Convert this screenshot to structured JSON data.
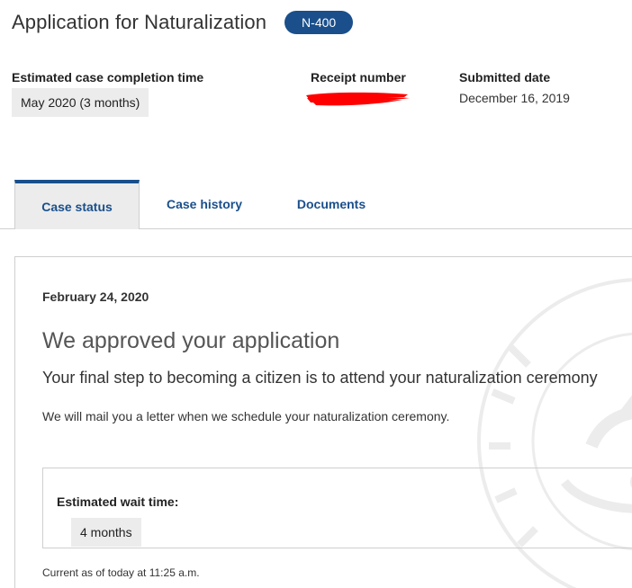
{
  "header": {
    "title": "Application for Naturalization",
    "form_badge": "N-400"
  },
  "meta": {
    "completion_label": "Estimated case completion time",
    "completion_value": "May 2020 (3 months)",
    "receipt_label": "Receipt number",
    "submitted_label": "Submitted date",
    "submitted_value": "December 16, 2019"
  },
  "tabs": [
    {
      "label": "Case status",
      "active": true
    },
    {
      "label": "Case history",
      "active": false
    },
    {
      "label": "Documents",
      "active": false
    }
  ],
  "status": {
    "date": "February 24, 2020",
    "heading": "We approved your application",
    "subheading": "Your final step to becoming a citizen is to attend your naturalization ceremony",
    "body": "We will mail you a letter when we schedule your naturalization ceremony.",
    "wait_label": "Estimated wait time:",
    "wait_value": "4 months",
    "current_as_of": "Current as of today at 11:25 a.m."
  },
  "colors": {
    "accent": "#1a4f8b",
    "chip_bg": "#ececec",
    "redaction": "#ff0000"
  }
}
